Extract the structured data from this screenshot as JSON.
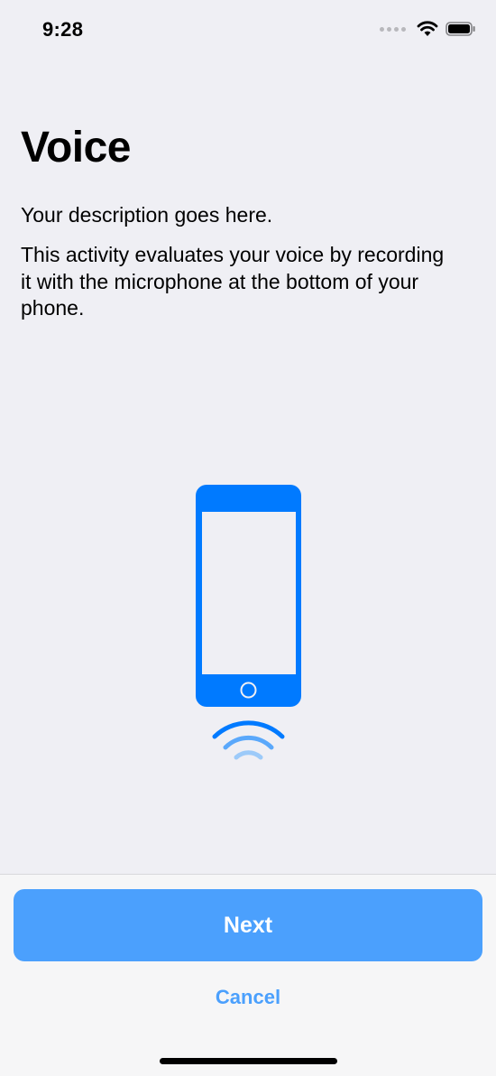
{
  "status_bar": {
    "time": "9:28",
    "icons": [
      "cellular-signal-icon",
      "wifi-icon",
      "battery-icon"
    ]
  },
  "page": {
    "title": "Voice",
    "subtitle": "Your description goes here.",
    "description": "This activity evaluates your voice by recording it with the microphone at the bottom of your phone.",
    "illustration": "phone-microphone-icon"
  },
  "footer": {
    "next_label": "Next",
    "cancel_label": "Cancel"
  },
  "colors": {
    "accent": "#007aff",
    "button": "#4ba0fd",
    "background": "#efeff4",
    "footer": "#f6f6f7"
  }
}
